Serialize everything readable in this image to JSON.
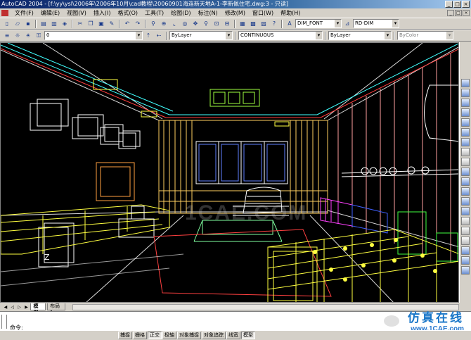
{
  "window": {
    "title": "AutoCAD 2004 - [f:\\yy\\ysl\\2006年\\2006年10月\\cad教程\\20060901海连新天地A-1-李新佩住宅.dwg:3 - 只读]",
    "controls": [
      "_",
      "□",
      "×"
    ]
  },
  "menubar": {
    "items": [
      "文件(F)",
      "编辑(E)",
      "视图(V)",
      "插入(I)",
      "格式(O)",
      "工具(T)",
      "绘图(D)",
      "标注(N)",
      "修改(M)",
      "窗口(W)",
      "帮助(H)"
    ]
  },
  "toolbar1": {
    "text_style": "DIM_FONT",
    "dim_style": "RD-DIM"
  },
  "toolbar2": {
    "layer": "0",
    "color": "ByLayer",
    "linetype": "CONTINUOUS",
    "lineweight": "ByLayer",
    "plotstyle": "ByColor"
  },
  "tabs": [
    "模型",
    "布局1"
  ],
  "command": {
    "prompt": "命令:"
  },
  "statusbar": {
    "buttons": [
      "捕捉",
      "栅格",
      "正交",
      "极轴",
      "对象捕捉",
      "对象追踪",
      "线宽",
      "模型"
    ],
    "active": [
      "正交",
      "模型"
    ]
  },
  "watermark": {
    "center_text": "1CAE.COM",
    "brand_cn": "仿真在线",
    "brand_url": "www.1CAE.com"
  },
  "drawing": {
    "ucs_label": "Z",
    "colors": {
      "yellow": "#ffff40",
      "white": "#ffffff",
      "cyan": "#40ffff",
      "red": "#ff4040",
      "green": "#40ff40",
      "magenta": "#ff40ff",
      "orange": "#ffa040"
    }
  }
}
